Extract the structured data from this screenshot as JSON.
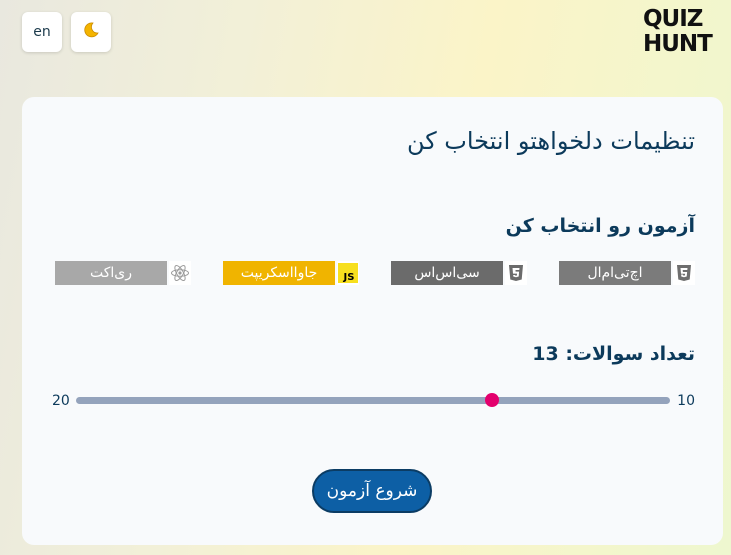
{
  "header": {
    "lang_label": "en",
    "theme_icon": "moon-icon",
    "logo_line1": "QUIZ",
    "logo_line2": "HUNT"
  },
  "settings": {
    "title": "تنظیمات دلخواهتو انتخاب کن",
    "quiz_heading": "آزمون رو انتخاب کن",
    "quizzes": [
      {
        "label": "اچ‌تی‌ام‌ال",
        "icon": "html5-icon",
        "color": "#7b7b7b"
      },
      {
        "label": "سی‌اس‌اس",
        "icon": "css3-icon",
        "color": "#6b6b6b"
      },
      {
        "label": "جاوااسکریپت",
        "icon": "javascript-icon",
        "color": "#f0b400"
      },
      {
        "label": "ری‌اکت",
        "icon": "react-icon",
        "color": "#a8a8a8"
      }
    ],
    "count_label": "تعداد سوالات: 13",
    "range_min": "10",
    "range_max": "20",
    "range_value": 13,
    "start_label": "شروع آزمون"
  },
  "colors": {
    "accent": "#e3006d",
    "primary": "#0d5fa5",
    "heading": "#0c3a5b"
  }
}
